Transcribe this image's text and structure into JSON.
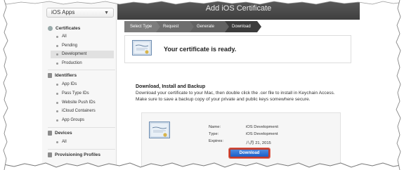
{
  "sidebar": {
    "app_select": "iOS Apps",
    "certificates": {
      "label": "Certificates",
      "items": [
        "All",
        "Pending",
        "Development",
        "Production"
      ]
    },
    "identifiers": {
      "label": "Identifiers",
      "items": [
        "App IDs",
        "Pass Type IDs",
        "Website Push IDs",
        "iCloud Containers",
        "App Groups"
      ]
    },
    "devices": {
      "label": "Devices",
      "items": [
        "All"
      ]
    },
    "provisioning": {
      "label": "Provisioning Profiles"
    }
  },
  "header": {
    "title": "Add iOS Certificate"
  },
  "steps": [
    "Select Type",
    "Request",
    "Generate",
    "Download"
  ],
  "ready": {
    "message": "Your certificate is ready."
  },
  "download_section": {
    "title": "Download, Install and Backup",
    "text": "Download your certificate to your Mac, then double click the .cer file to install in Keychain Access. Make sure to save a backup copy of your private and public keys somewhere secure."
  },
  "certificate": {
    "name_label": "Name:",
    "name_value": "",
    "type_label": "Type:",
    "type_value": "iOS Development",
    "expires_label": "Expires:",
    "expires_value": "八月 21, 2015",
    "prefix_value": "iOS Development:",
    "download_label": "Download"
  },
  "colors": {
    "accent_blue": "#1c5fc8",
    "highlight_red": "#c03a2b",
    "topbar": "#4a4a4a"
  }
}
